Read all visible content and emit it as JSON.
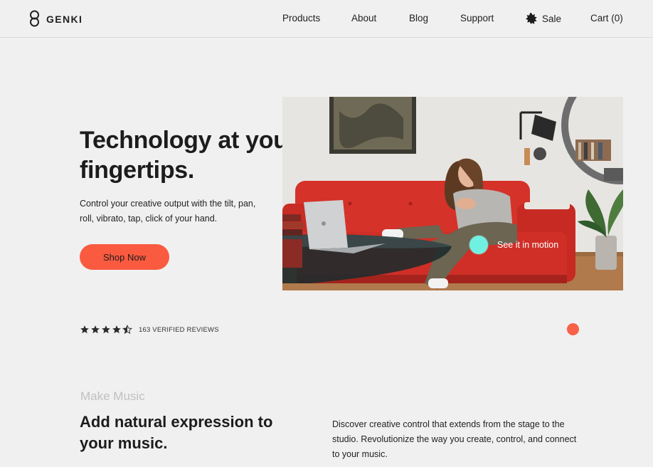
{
  "header": {
    "brand": "GENKI",
    "nav": {
      "products": "Products",
      "about": "About",
      "blog": "Blog",
      "support": "Support",
      "sale": "Sale",
      "cart": "Cart (0)"
    }
  },
  "hero": {
    "title": "Technology at your fingertips.",
    "subtitle": "Control your creative output with the tilt, pan, roll, vibrato, tap, click of your hand.",
    "cta_label": "Shop Now",
    "motion_label": "See it in motion",
    "rating_stars": 4.5,
    "reviews_label": "163 VERIFIED REVIEWS"
  },
  "section": {
    "eyebrow": "Make Music",
    "title": "Add natural expression to your music.",
    "body": "Discover creative control that extends from the stage to the studio. Revolutionize the way you create, control, and connect to your music."
  },
  "colors": {
    "accent": "#fa5a40",
    "motion_dot": "#6ff0e0",
    "background": "#f0f0f0"
  },
  "icons": {
    "logo": "genki-logo-icon",
    "sale": "sale-burst-icon",
    "star": "star-icon"
  }
}
